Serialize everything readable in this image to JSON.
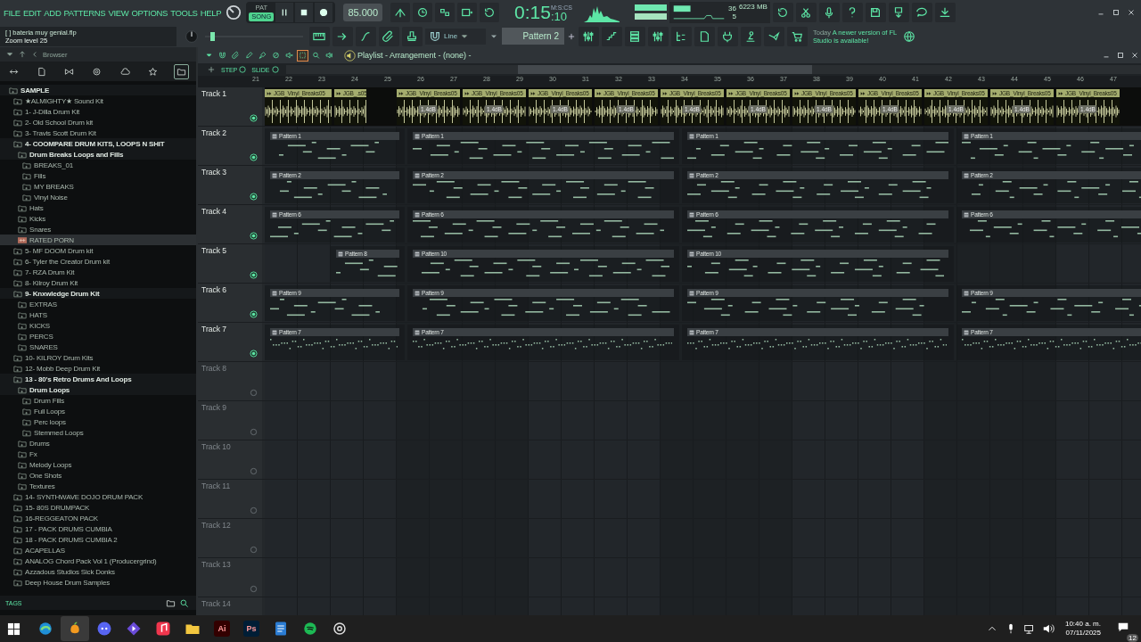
{
  "menu": [
    "FILE",
    "EDIT",
    "ADD",
    "PATTERNS",
    "VIEW",
    "OPTIONS",
    "TOOLS",
    "HELP"
  ],
  "modes": [
    {
      "label": "PAT",
      "selected": false
    },
    {
      "label": "SONG",
      "selected": true
    }
  ],
  "tempo": "85.000",
  "time": {
    "unit": "M:S:CS",
    "main": "0:15",
    "sub": ":10"
  },
  "monitor": {
    "cpu": "36",
    "memory": "6223 MB",
    "polyphony": "5"
  },
  "hint": {
    "title": "[ ] bateria muy genial.flp",
    "message": "Zoom level 25"
  },
  "master_pitch": {
    "level": 0.05
  },
  "snap": "Line",
  "pattern": "Pattern 2",
  "news": {
    "day": "Today",
    "message": "A newer version of FL Studio is available!"
  },
  "browser": {
    "title": "Browser",
    "tags": "TAGS",
    "tree": [
      {
        "label": "SAMPLE",
        "kind": "folder",
        "selected": false,
        "children": [
          {
            "label": "★ALMIGHTY★ Sound Kit",
            "kind": "folder",
            "selected": false
          },
          {
            "label": "1- J-Dilla Drum Kit",
            "kind": "folder",
            "selected": false
          },
          {
            "label": "2- Old School Drum kit",
            "kind": "folder",
            "selected": false
          },
          {
            "label": "3- Travis Scott Drum Kit",
            "kind": "folder",
            "selected": false
          },
          {
            "label": "4- COOMPARE DRUM KITS, LOOPS N SHIT",
            "kind": "folder",
            "selected": false,
            "children": [
              {
                "label": "Drum Breaks Loops and Fills",
                "kind": "folder",
                "selected": false,
                "children": [
                  {
                    "label": "BREAKS_01",
                    "kind": "folder",
                    "selected": false
                  },
                  {
                    "label": "Fills",
                    "kind": "folder",
                    "selected": false
                  },
                  {
                    "label": "MY BREAKS",
                    "kind": "folder",
                    "selected": false
                  },
                  {
                    "label": "Vinyl Noise",
                    "kind": "folder",
                    "selected": false
                  }
                ]
              },
              {
                "label": "Hats",
                "kind": "folder",
                "selected": false
              },
              {
                "label": "Kicks",
                "kind": "folder",
                "selected": false
              },
              {
                "label": "Snares",
                "kind": "folder",
                "selected": false
              },
              {
                "label": "RATED PORN",
                "kind": "file",
                "selected": true
              }
            ]
          },
          {
            "label": "5- MF DOOM Drum kit",
            "kind": "folder",
            "selected": false
          },
          {
            "label": "6- Tyler the Creator Drum kit",
            "kind": "folder",
            "selected": false
          },
          {
            "label": "7- RZA Drum Kit",
            "kind": "folder",
            "selected": false
          },
          {
            "label": "8- Kilroy Drum Kit",
            "kind": "folder",
            "selected": false
          },
          {
            "label": "9- Knxwledge Drum Kit",
            "kind": "folder",
            "selected": false,
            "children": [
              {
                "label": "EXTRAS",
                "kind": "folder",
                "selected": false
              },
              {
                "label": "HATS",
                "kind": "folder",
                "selected": false
              },
              {
                "label": "KICKS",
                "kind": "folder",
                "selected": false
              },
              {
                "label": "PERCS",
                "kind": "folder",
                "selected": false
              },
              {
                "label": "SNARES",
                "kind": "folder",
                "selected": false
              }
            ]
          },
          {
            "label": "10- KILROY Drum Kits",
            "kind": "folder",
            "selected": false
          },
          {
            "label": "12- Mobb Deep Drum Kit",
            "kind": "folder",
            "selected": false
          },
          {
            "label": "13 - 80's Retro Drums And Loops",
            "kind": "folder",
            "selected": false,
            "children": [
              {
                "label": "Drum Loops",
                "kind": "folder",
                "selected": false,
                "children": [
                  {
                    "label": "Drum Fills",
                    "kind": "folder",
                    "selected": false
                  },
                  {
                    "label": "Full Loops",
                    "kind": "folder",
                    "selected": false
                  },
                  {
                    "label": "Perc loops",
                    "kind": "folder",
                    "selected": false
                  },
                  {
                    "label": "Stemmed Loops",
                    "kind": "folder",
                    "selected": false
                  }
                ]
              },
              {
                "label": "Drums",
                "kind": "folder",
                "selected": false
              },
              {
                "label": "Fx",
                "kind": "folder",
                "selected": false
              },
              {
                "label": "Melody Loops",
                "kind": "folder",
                "selected": false
              },
              {
                "label": "One Shots",
                "kind": "folder",
                "selected": false
              },
              {
                "label": "Textures",
                "kind": "folder",
                "selected": false
              }
            ]
          },
          {
            "label": "14- SYNTHWAVE DOJO DRUM PACK",
            "kind": "folder",
            "selected": false
          },
          {
            "label": "15- 80S DRUMPACK",
            "kind": "folder",
            "selected": false
          },
          {
            "label": "16-REGGEATON PACK",
            "kind": "folder",
            "selected": false
          },
          {
            "label": "17 - PACK DRUMS CUMBIA",
            "kind": "folder",
            "selected": false
          },
          {
            "label": "18 - PACK DRUMS CUMBIA 2",
            "kind": "folder",
            "selected": false
          },
          {
            "label": "ACAPELLAS",
            "kind": "folder",
            "selected": false
          },
          {
            "label": "ANALOG Chord Pack Vol 1 (Producergrind)",
            "kind": "folder",
            "selected": false
          },
          {
            "label": "Azzadous Studios Sick Donks",
            "kind": "folder",
            "selected": false
          },
          {
            "label": "Deep House Drum Samples",
            "kind": "folder",
            "selected": false
          }
        ]
      }
    ]
  },
  "playlist": {
    "title": "Playlist - Arrangement - (none) -",
    "step": "STEP",
    "slide": "SLIDE",
    "tools": [
      {
        "selected": false
      },
      {
        "selected": false
      },
      {
        "selected": false
      },
      {
        "selected": false
      },
      {
        "selected": false
      },
      {
        "selected": false
      },
      {
        "selected": false
      },
      {
        "selected": true
      },
      {
        "selected": false
      },
      {
        "selected": false
      }
    ],
    "ruler": [
      "21",
      "22",
      "23",
      "24",
      "25",
      "26",
      "27",
      "28",
      "29",
      "30",
      "31",
      "32",
      "33",
      "34",
      "35",
      "36",
      "37",
      "38",
      "39",
      "40",
      "41",
      "42",
      "43",
      "44",
      "45",
      "46",
      "47"
    ],
    "tracks": [
      {
        "name": "Track 1",
        "active": true,
        "kind": "audio",
        "clips": [
          {
            "label": "JGB_Vinyl_Breaks05"
          },
          {
            "label": "JGB_.s05"
          },
          {
            "label": "JGB_Vinyl_Breaks05",
            "gain": "1.4dB"
          },
          {
            "label": "JGB_Vinyl_Breaks05",
            "gain": "1.4dB"
          },
          {
            "label": "JGB_Vinyl_Breaks05",
            "gain": "1.4dB"
          },
          {
            "label": "JGB_Vinyl_Breaks05",
            "gain": "1.4dB"
          },
          {
            "label": "JGB_Vinyl_Breaks05",
            "gain": "1.4dB"
          },
          {
            "label": "JGB_Vinyl_Breaks05",
            "gain": "1.4dB"
          },
          {
            "label": "JGB_Vinyl_Breaks05",
            "gain": "1.4dB"
          },
          {
            "label": "JGB_Vinyl_Breaks05",
            "gain": "1.4dB"
          },
          {
            "label": "JGB_Vinyl_Breaks05",
            "gain": "1.4dB"
          },
          {
            "label": "JGB_Vinyl_Breaks05",
            "gain": "1.4dB"
          },
          {
            "label": "JGB_Vinyl_Breaks05",
            "gain": "1.4dB"
          }
        ]
      },
      {
        "name": "Track 2",
        "active": true,
        "kind": "pattern",
        "clips": [
          {
            "label": "Pattern 1"
          },
          {
            "label": "Pattern 1"
          },
          {
            "label": "Pattern 1"
          },
          {
            "label": "Pattern 1"
          }
        ]
      },
      {
        "name": "Track 3",
        "active": true,
        "kind": "pattern",
        "clips": [
          {
            "label": "Pattern 2"
          },
          {
            "label": "Pattern 2"
          },
          {
            "label": "Pattern 2"
          },
          {
            "label": "Pattern 2"
          }
        ]
      },
      {
        "name": "Track 4",
        "active": true,
        "kind": "pattern",
        "clips": [
          {
            "label": "Pattern 6"
          },
          {
            "label": "Pattern 6"
          },
          {
            "label": "Pattern 6"
          },
          {
            "label": "Pattern 6"
          }
        ]
      },
      {
        "name": "Track 5",
        "active": true,
        "kind": "pattern",
        "clips": [
          {
            "label": "Pattern 8"
          },
          {
            "label": "Pattern 10"
          },
          {
            "label": "Pattern 10"
          }
        ]
      },
      {
        "name": "Track 6",
        "active": true,
        "kind": "pattern",
        "clips": [
          {
            "label": "Pattern 9"
          },
          {
            "label": "Pattern 9"
          },
          {
            "label": "Pattern 9"
          },
          {
            "label": "Pattern 9"
          }
        ]
      },
      {
        "name": "Track 7",
        "active": true,
        "kind": "pattern",
        "clips": [
          {
            "label": "Pattern 7"
          },
          {
            "label": "Pattern 7"
          },
          {
            "label": "Pattern 7"
          },
          {
            "label": "Pattern 7"
          }
        ]
      },
      {
        "name": "Track 8",
        "active": false,
        "kind": "pattern"
      },
      {
        "name": "Track 9",
        "active": false,
        "kind": "pattern"
      },
      {
        "name": "Track 10",
        "active": false,
        "kind": "pattern"
      },
      {
        "name": "Track 11",
        "active": false,
        "kind": "pattern"
      },
      {
        "name": "Track 12",
        "active": false,
        "kind": "pattern"
      },
      {
        "name": "Track 13",
        "active": false,
        "kind": "pattern"
      },
      {
        "name": "Track 14",
        "active": false,
        "kind": "pattern"
      }
    ]
  },
  "taskbar": {
    "apps": [
      {
        "kind": "swirl",
        "selected": false
      },
      {
        "kind": "fruit",
        "selected": true
      },
      {
        "kind": "gamepad",
        "selected": false
      },
      {
        "kind": "diamond",
        "selected": false
      },
      {
        "kind": "music",
        "selected": false
      },
      {
        "kind": "folder",
        "selected": false
      },
      {
        "kind": "tile",
        "label": "Ai",
        "color": "#330000",
        "selected": false
      },
      {
        "kind": "tile",
        "label": "Ps",
        "color": "#001e36",
        "selected": false
      },
      {
        "kind": "document",
        "selected": false
      },
      {
        "kind": "ring",
        "selected": false
      },
      {
        "kind": "gear",
        "selected": false
      }
    ],
    "time": "10:40 a. m.",
    "date": "07/11/2025",
    "notifications": "12"
  }
}
